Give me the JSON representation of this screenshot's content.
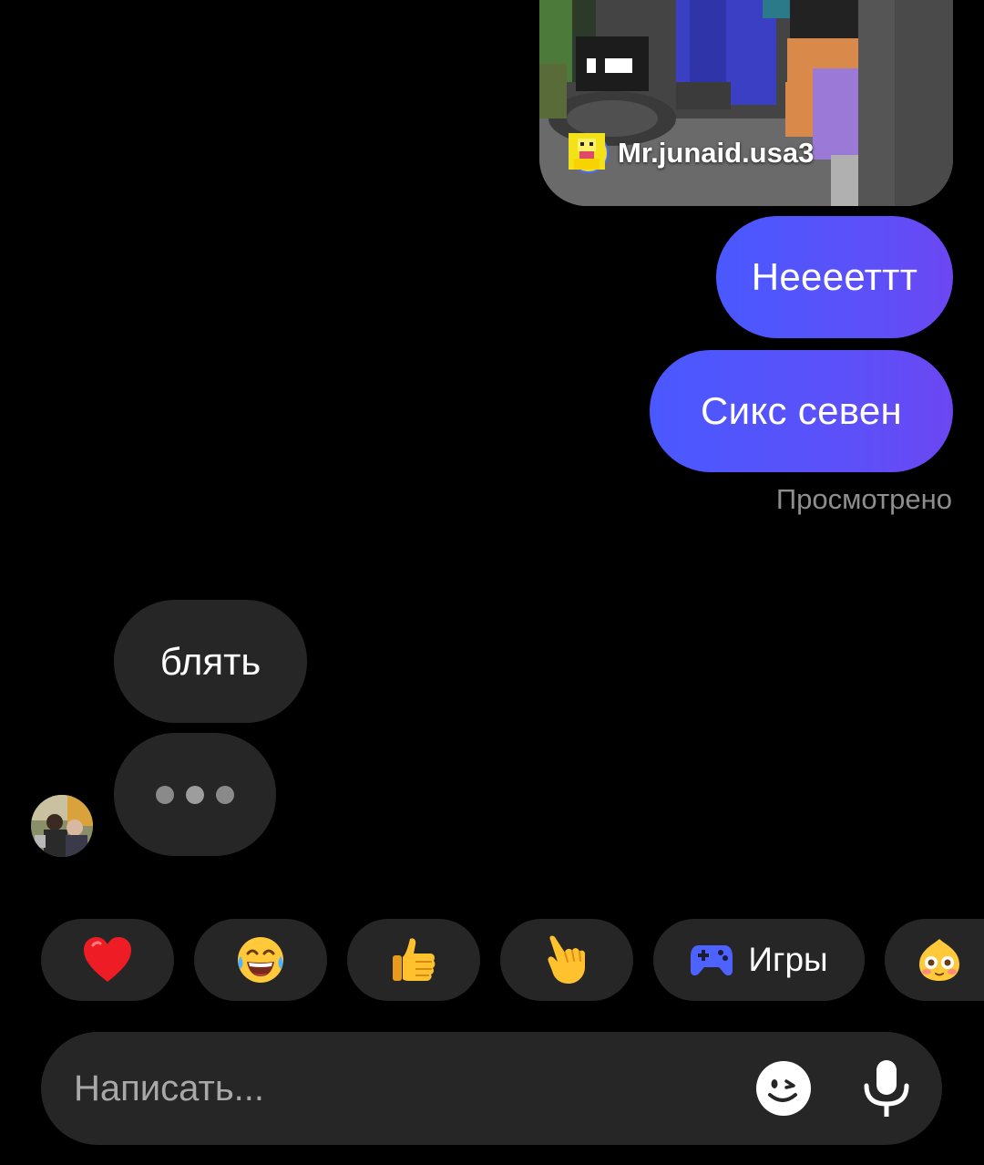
{
  "shared_post": {
    "author": "Mr.junaid.usa3"
  },
  "messages": {
    "outgoing": [
      {
        "text": "Нееееттт"
      },
      {
        "text": "Сикс севен"
      }
    ],
    "seen_label": "Просмотрено",
    "incoming": [
      {
        "text": "блять"
      }
    ]
  },
  "quick_reactions": [
    {
      "icon": "red-heart-emoji"
    },
    {
      "icon": "tears-of-joy-emoji"
    },
    {
      "icon": "thumbs-up-emoji"
    },
    {
      "icon": "pointing-hand-emoji"
    }
  ],
  "games_chip": {
    "label": "Игры",
    "icon": "gamepad-icon"
  },
  "composer": {
    "placeholder": "Написать..."
  },
  "colors": {
    "background": "#000000",
    "outgoing_bubble": "#5b52fb",
    "incoming_bubble": "#262626",
    "secondary_text": "#8e8e8e"
  }
}
